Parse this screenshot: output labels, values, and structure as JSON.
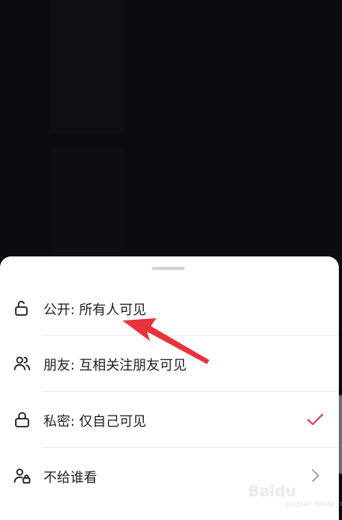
{
  "privacy_sheet": {
    "options": [
      {
        "icon": "unlock-icon",
        "label": "公开: 所有人可见"
      },
      {
        "icon": "friends-icon",
        "label": "朋友: 互相关注朋友可见"
      },
      {
        "icon": "lock-icon",
        "label": "私密: 仅自己可见",
        "selected": true
      },
      {
        "icon": "user-lock-icon",
        "label": "不给谁看",
        "has_chevron": true
      }
    ]
  },
  "colors": {
    "check_accent": "#ea3a50",
    "annotation_arrow": "#e8333c",
    "sheet_bg": "#ffffff",
    "backdrop": "#0a0b10"
  },
  "watermark": {
    "brand": "Baidu",
    "sub": "jingyan.baidu.com"
  }
}
